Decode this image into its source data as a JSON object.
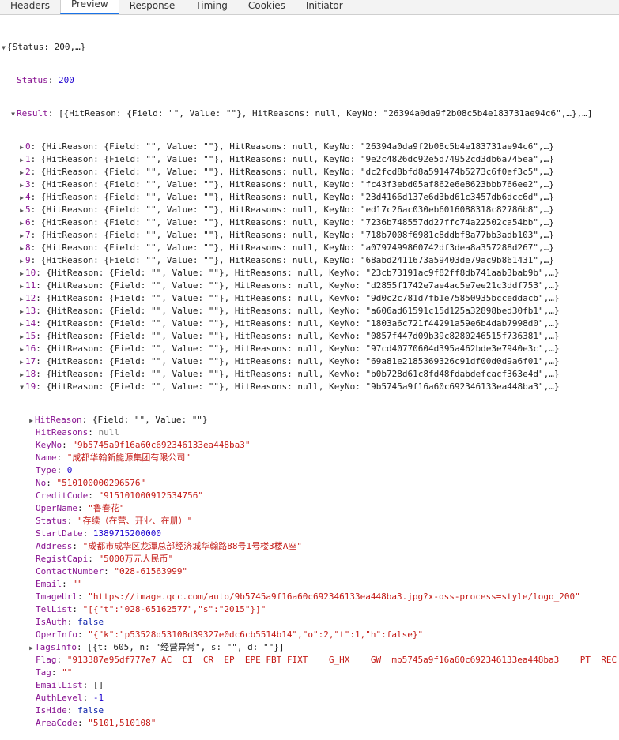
{
  "tabs": [
    "Headers",
    "Preview",
    "Response",
    "Timing",
    "Cookies",
    "Initiator"
  ],
  "active_tab": "Preview",
  "root_summary": "{Status: 200,…}",
  "status_line": {
    "key": "Status",
    "value": "200"
  },
  "result_summary": {
    "key": "Result",
    "value": "[{HitReason: {Field: \"\", Value: \"\"}, HitReasons: null, KeyNo: \"26394a0da9f2b08c5b4e183731ae94c6\",…},…]"
  },
  "result_items": [
    {
      "idx": "0",
      "text": "{HitReason: {Field: \"\", Value: \"\"}, HitReasons: null, KeyNo: \"26394a0da9f2b08c5b4e183731ae94c6\",…}"
    },
    {
      "idx": "1",
      "text": "{HitReason: {Field: \"\", Value: \"\"}, HitReasons: null, KeyNo: \"9e2c4826dc92e5d74952cd3db6a745ea\",…}"
    },
    {
      "idx": "2",
      "text": "{HitReason: {Field: \"\", Value: \"\"}, HitReasons: null, KeyNo: \"dc2fcd8bfd8a591474b5273c6f0ef3c5\",…}"
    },
    {
      "idx": "3",
      "text": "{HitReason: {Field: \"\", Value: \"\"}, HitReasons: null, KeyNo: \"fc43f3ebd05af862e6e8623bbb766ee2\",…}"
    },
    {
      "idx": "4",
      "text": "{HitReason: {Field: \"\", Value: \"\"}, HitReasons: null, KeyNo: \"23d4166d137e6d3bd61c3457db6dcc6d\",…}"
    },
    {
      "idx": "5",
      "text": "{HitReason: {Field: \"\", Value: \"\"}, HitReasons: null, KeyNo: \"ed17c26ac030eb6016088318c82786b8\",…}"
    },
    {
      "idx": "6",
      "text": "{HitReason: {Field: \"\", Value: \"\"}, HitReasons: null, KeyNo: \"7236b748557dd27ffc74a22502ca54bb\",…}"
    },
    {
      "idx": "7",
      "text": "{HitReason: {Field: \"\", Value: \"\"}, HitReasons: null, KeyNo: \"718b7008f6981c8ddbf8a77bb3adb103\",…}"
    },
    {
      "idx": "8",
      "text": "{HitReason: {Field: \"\", Value: \"\"}, HitReasons: null, KeyNo: \"a0797499860742df3dea8a357288d267\",…}"
    },
    {
      "idx": "9",
      "text": "{HitReason: {Field: \"\", Value: \"\"}, HitReasons: null, KeyNo: \"68abd2411673a59403de79ac9b861431\",…}"
    },
    {
      "idx": "10",
      "text": "{HitReason: {Field: \"\", Value: \"\"}, HitReasons: null, KeyNo: \"23cb73191ac9f82ff8db741aab3bab9b\",…}"
    },
    {
      "idx": "11",
      "text": "{HitReason: {Field: \"\", Value: \"\"}, HitReasons: null, KeyNo: \"d2855f1742e7ae4ac5e7ee21c3ddf753\",…}"
    },
    {
      "idx": "12",
      "text": "{HitReason: {Field: \"\", Value: \"\"}, HitReasons: null, KeyNo: \"9d0c2c781d7fb1e75850935bcceddacb\",…}"
    },
    {
      "idx": "13",
      "text": "{HitReason: {Field: \"\", Value: \"\"}, HitReasons: null, KeyNo: \"a606ad61591c15d125a32898bed30fb1\",…}"
    },
    {
      "idx": "14",
      "text": "{HitReason: {Field: \"\", Value: \"\"}, HitReasons: null, KeyNo: \"1803a6c721f44291a59e6b4dab7998d0\",…}"
    },
    {
      "idx": "15",
      "text": "{HitReason: {Field: \"\", Value: \"\"}, HitReasons: null, KeyNo: \"0857f447d09b39c8280246515f736381\",…}"
    },
    {
      "idx": "16",
      "text": "{HitReason: {Field: \"\", Value: \"\"}, HitReasons: null, KeyNo: \"97cd40770604d395a462bde3e7940e3c\",…}"
    },
    {
      "idx": "17",
      "text": "{HitReason: {Field: \"\", Value: \"\"}, HitReasons: null, KeyNo: \"69a81e2185369326c91df00d0d9a6f01\",…}"
    },
    {
      "idx": "18",
      "text": "{HitReason: {Field: \"\", Value: \"\"}, HitReasons: null, KeyNo: \"b0b728d61c8fd48fdabdefcacf363e4d\",…}"
    },
    {
      "idx": "19",
      "text": "{HitReason: {Field: \"\", Value: \"\"}, HitReasons: null, KeyNo: \"9b5745a9f16a60c692346133ea448ba3\",…}"
    }
  ],
  "expanded_fields": [
    {
      "key": "HitReason",
      "value": "{Field: \"\", Value: \"\"}",
      "type": "plain",
      "expandable": true
    },
    {
      "key": "HitReasons",
      "value": "null",
      "type": "null",
      "expandable": false
    },
    {
      "key": "KeyNo",
      "value": "\"9b5745a9f16a60c692346133ea448ba3\"",
      "type": "str",
      "expandable": false
    },
    {
      "key": "Name",
      "value": "\"成都华翰新能源集团有限公司\"",
      "type": "str",
      "expandable": false
    },
    {
      "key": "Type",
      "value": "0",
      "type": "num",
      "expandable": false
    },
    {
      "key": "No",
      "value": "\"510100000296576\"",
      "type": "str",
      "expandable": false
    },
    {
      "key": "CreditCode",
      "value": "\"915101000912534756\"",
      "type": "str",
      "expandable": false
    },
    {
      "key": "OperName",
      "value": "\"鲁春花\"",
      "type": "str",
      "expandable": false
    },
    {
      "key": "Status",
      "value": "\"存续（在营、开业、在册）\"",
      "type": "str",
      "expandable": false
    },
    {
      "key": "StartDate",
      "value": "1389715200000",
      "type": "num",
      "expandable": false
    },
    {
      "key": "Address",
      "value": "\"成都市成华区龙潭总部经济城华翰路88号1号楼3楼A座\"",
      "type": "str",
      "expandable": false
    },
    {
      "key": "RegistCapi",
      "value": "\"5000万元人民币\"",
      "type": "str",
      "expandable": false
    },
    {
      "key": "ContactNumber",
      "value": "\"028-61563999\"",
      "type": "str",
      "expandable": false
    },
    {
      "key": "Email",
      "value": "\"\"",
      "type": "str",
      "expandable": false
    },
    {
      "key": "ImageUrl",
      "value": "\"https://image.qcc.com/auto/9b5745a9f16a60c692346133ea448ba3.jpg?x-oss-process=style/logo_200\"",
      "type": "str",
      "expandable": false
    },
    {
      "key": "TelList",
      "value": "\"[{\"t\":\"028-65162577\",\"s\":\"2015\"}]\"",
      "type": "str",
      "expandable": false
    },
    {
      "key": "IsAuth",
      "value": "false",
      "type": "kw",
      "expandable": false
    },
    {
      "key": "OperInfo",
      "value": "\"{\"k\":\"p53528d53108d39327e0dc6cb5514b14\",\"o\":2,\"t\":1,\"h\":false}\"",
      "type": "str",
      "expandable": false
    },
    {
      "key": "TagsInfo",
      "value": "[{t: 605, n: \"经营异常\", s: \"\", d: \"\"}]",
      "type": "plain",
      "expandable": true
    },
    {
      "key": "Flag",
      "value": "\"913387e95df777e7 AC  CI  CR  EP  EPE FBT FIXT    G_HX    GW  mb5745a9f16a60c692346133ea448ba3    PT  REC",
      "type": "str",
      "expandable": false
    },
    {
      "key": "Tag",
      "value": "\"\"",
      "type": "str",
      "expandable": false
    },
    {
      "key": "EmailList",
      "value": "[]",
      "type": "plain",
      "expandable": false
    },
    {
      "key": "AuthLevel",
      "value": "-1",
      "type": "num",
      "expandable": false
    },
    {
      "key": "IsHide",
      "value": "false",
      "type": "kw",
      "expandable": false
    },
    {
      "key": "AreaCode",
      "value": "\"5101,510108\"",
      "type": "str",
      "expandable": false
    }
  ]
}
